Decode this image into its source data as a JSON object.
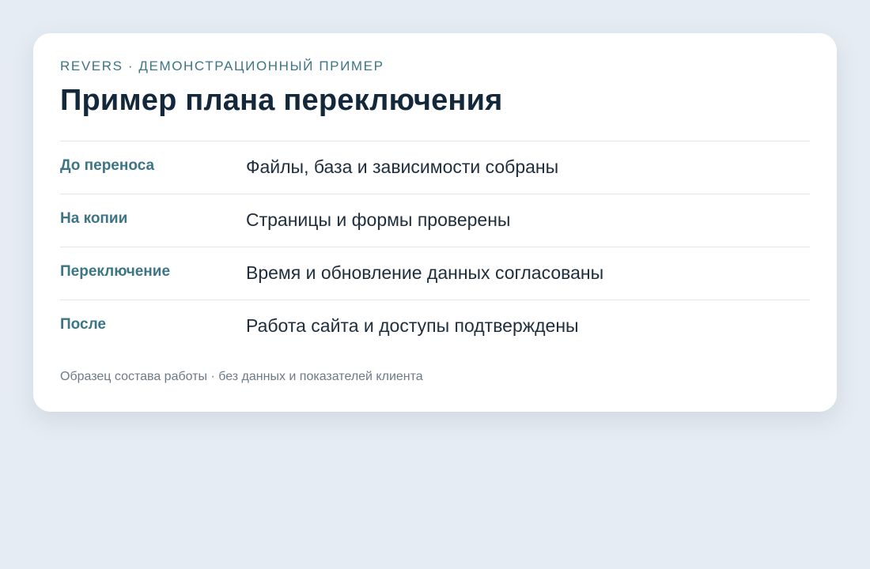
{
  "card": {
    "eyebrow": "REVERS · ДЕМОНСТРАЦИОННЫЙ ПРИМЕР",
    "title": "Пример плана переключения",
    "rows": [
      {
        "label": "До переноса",
        "value": "Файлы, база и зависимости собраны"
      },
      {
        "label": "На копии",
        "value": "Страницы и формы проверены"
      },
      {
        "label": "Переключение",
        "value": "Время и обновление данных согласованы"
      },
      {
        "label": "После",
        "value": "Работа сайта и доступы подтверждены"
      }
    ],
    "footnote": "Образец состава работы · без данных и показателей клиента"
  },
  "colors": {
    "background": "#e6ecf3",
    "card": "#ffffff",
    "accent": "#3d7585",
    "title": "#14283b",
    "text": "#1e2e3c",
    "muted": "#6d7b87",
    "divider": "#e2e6ea"
  }
}
